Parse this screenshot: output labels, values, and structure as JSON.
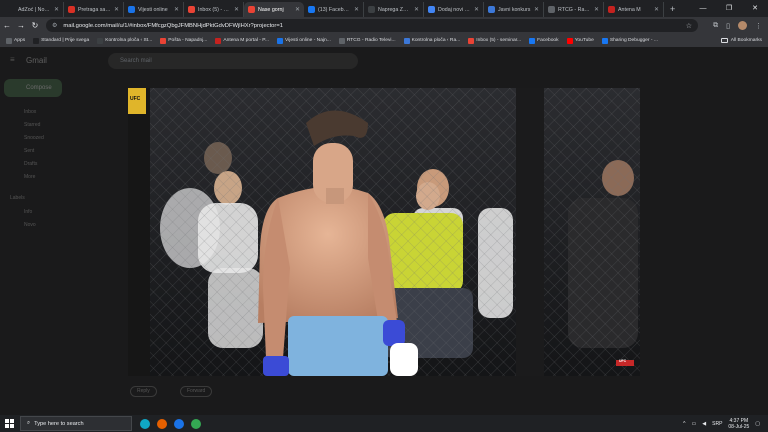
{
  "browser": {
    "tabs": [
      {
        "label": "AdZoć | Novosti",
        "color": "#202124",
        "active": false
      },
      {
        "label": "Pretraga sadržaja",
        "color": "#d93025",
        "active": false
      },
      {
        "label": "Vijesti online",
        "color": "#1a73e8",
        "active": false
      },
      {
        "label": "Inbox (5) - semi",
        "color": "#ea4335",
        "active": false
      },
      {
        "label": "Nase gornj",
        "color": "#ea4335",
        "active": true
      },
      {
        "label": "(13) Facebook",
        "color": "#1877f2",
        "active": false
      },
      {
        "label": "Naprega Zaspor",
        "color": "#3c4043",
        "active": false
      },
      {
        "label": "Dodaj novi čla",
        "color": "#4285f4",
        "active": false
      },
      {
        "label": "Javni konkurs",
        "color": "#3c78d8",
        "active": false
      },
      {
        "label": "RTCG - Radio",
        "color": "#5f6368",
        "active": false
      },
      {
        "label": "Antena M",
        "color": "#c5221f",
        "active": false
      }
    ],
    "new_tab": "+",
    "url": "mail.google.com/mail/u/1/#inbox/FMfcgzQbgJFMBNHjdPktGdvDFWjlHXr?projector=1",
    "bookmarks": [
      {
        "label": "Apps",
        "color": "#5f6368"
      },
      {
        "label": "Standard | Prije svega",
        "color": "#202124"
      },
      {
        "label": "Kontrolna ploča ‹ St...",
        "color": "#3c4043"
      },
      {
        "label": "Pošta - Napadnj...",
        "color": "#ea4335"
      },
      {
        "label": "Antena M portal - P...",
        "color": "#c5221f"
      },
      {
        "label": "Vijesti online - Najn...",
        "color": "#1a73e8"
      },
      {
        "label": "RTCG - Radio Televi...",
        "color": "#5f6368"
      },
      {
        "label": "Kontrolna ploča ‹ Ra...",
        "color": "#3c78d8"
      },
      {
        "label": "Inbox (5) - seminar...",
        "color": "#ea4335"
      },
      {
        "label": "Facebook",
        "color": "#1877f2"
      },
      {
        "label": "YouTube",
        "color": "#ff0000"
      },
      {
        "label": "Sharing Debugger - ...",
        "color": "#1877f2"
      }
    ],
    "all_bookmarks": "All Bookmarks"
  },
  "gmail": {
    "logo": "Gmail",
    "search_placeholder": "Search mail",
    "compose": "Compose",
    "nav": [
      "Inbox",
      "Starred",
      "Snoozed",
      "Sent",
      "Drafts",
      "More"
    ],
    "labels_heading": "Labels",
    "labels": [
      "Info",
      "Novo"
    ],
    "reply": "Reply",
    "forward": "Forward"
  },
  "video": {
    "watermark": "UFC",
    "corner_logo": "UFC"
  },
  "taskbar": {
    "search_placeholder": "Type here to search",
    "apps": [
      {
        "name": "edge-icon",
        "color": "#0fa7c4"
      },
      {
        "name": "firefox-icon",
        "color": "#e66000"
      },
      {
        "name": "mail-icon",
        "color": "#1a73e8"
      },
      {
        "name": "chrome-icon",
        "color": "#34a853"
      }
    ],
    "lang": "SRP",
    "time": "4:37 PM",
    "date": "08-Jul-25"
  },
  "colors": {
    "accent": "#8ab4f8",
    "frame": "#202124",
    "toolbar": "#35363a"
  }
}
